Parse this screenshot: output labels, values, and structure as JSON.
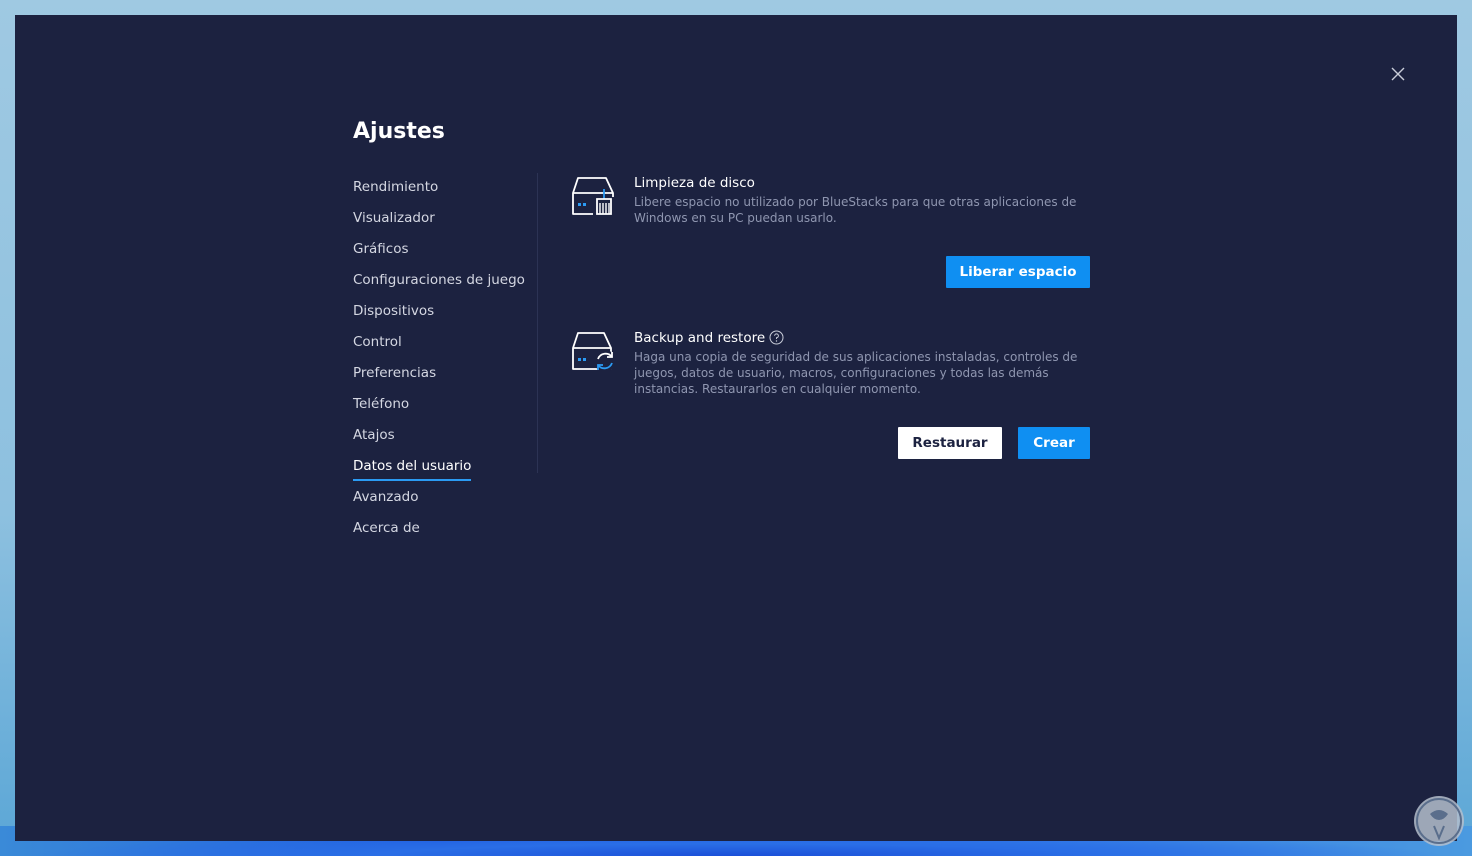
{
  "window": {
    "close_icon": "close-icon"
  },
  "page": {
    "title": "Ajustes"
  },
  "sidebar": {
    "items": [
      {
        "label": "Rendimiento"
      },
      {
        "label": "Visualizador"
      },
      {
        "label": "Gráficos"
      },
      {
        "label": "Configuraciones de juego"
      },
      {
        "label": "Dispositivos"
      },
      {
        "label": "Control"
      },
      {
        "label": "Preferencias"
      },
      {
        "label": "Teléfono"
      },
      {
        "label": "Atajos"
      },
      {
        "label": "Datos del usuario",
        "active": true
      },
      {
        "label": "Avanzado"
      },
      {
        "label": "Acerca de"
      }
    ]
  },
  "disk_cleanup": {
    "icon": "disk-cleanup-icon",
    "title": "Limpieza de disco",
    "description": "Libere espacio no utilizado por BlueStacks para que otras aplicaciones de Windows en su PC puedan usarlo.",
    "button_label": "Liberar espacio"
  },
  "backup": {
    "icon": "backup-restore-icon",
    "title": "Backup and restore",
    "help_icon": "help-icon",
    "description": "Haga una copia de seguridad de sus aplicaciones instaladas, controles de juegos, datos de usuario, macros, configuraciones y todas las demás instancias. Restaurarlos en cualquier momento.",
    "restore_label": "Restaurar",
    "create_label": "Crear"
  },
  "colors": {
    "window_bg": "#1c2240",
    "accent": "#0f8ff2",
    "active_underline": "#2b9bf4"
  }
}
